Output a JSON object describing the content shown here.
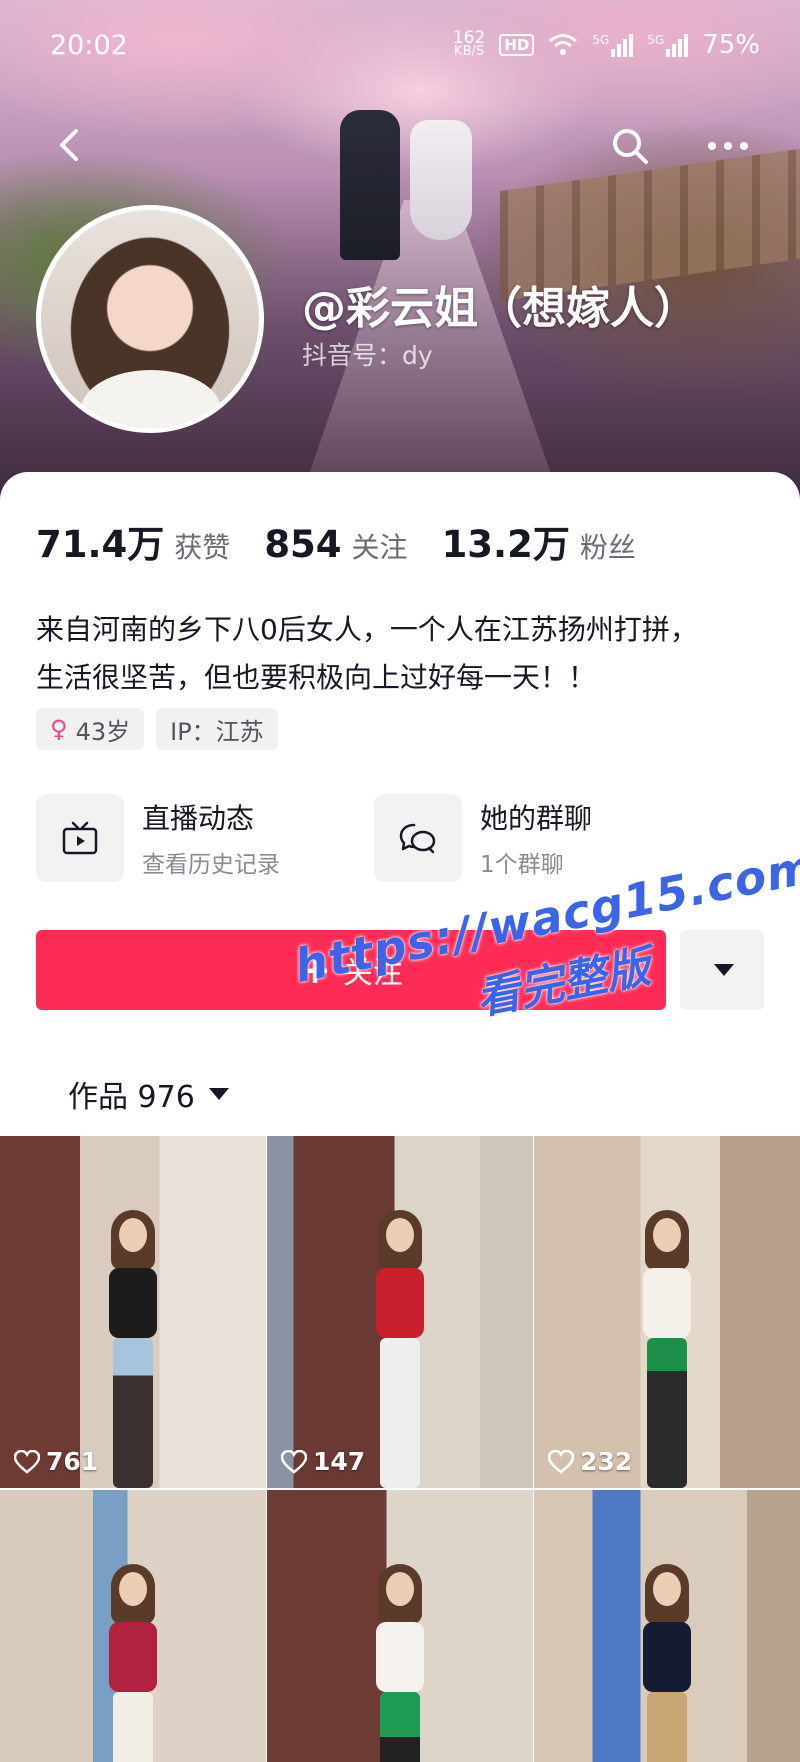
{
  "status_bar": {
    "time": "20:02",
    "net_speed_value": "162",
    "net_speed_unit": "KB/S",
    "hd_badge": "HD",
    "net_label_1": "5G",
    "net_label_2": "5G",
    "battery": "75%"
  },
  "profile": {
    "nickname": "@彩云姐（想嫁人）",
    "douyin_id": "抖音号：dy"
  },
  "stats": [
    {
      "value": "71.4万",
      "label": "获赞"
    },
    {
      "value": "854",
      "label": "关注"
    },
    {
      "value": "13.2万",
      "label": "粉丝"
    }
  ],
  "bio": {
    "line1": "来自河南的乡下八0后女人，一个人在江苏扬州打拼，",
    "line2": "生活很坚苦，但也要积极向上过好每一天！！"
  },
  "tags": {
    "age": "43岁",
    "ip": "IP：江苏"
  },
  "features": {
    "live": {
      "title": "直播动态",
      "subtitle": "查看历史记录",
      "icon": "tv-icon"
    },
    "group": {
      "title": "她的群聊",
      "subtitle": "1个群聊",
      "icon": "chat-bubbles-icon"
    }
  },
  "follow_button": {
    "label": "关注"
  },
  "works_tab": {
    "label": "作品 976"
  },
  "watermark": {
    "url": "https://wacg15.com",
    "text": "看完整版"
  },
  "videos": [
    {
      "likes": "761"
    },
    {
      "likes": "147"
    },
    {
      "likes": "232"
    },
    {
      "likes": ""
    },
    {
      "likes": ""
    },
    {
      "likes": ""
    }
  ],
  "colors": {
    "follow_accent": "#fe2c55",
    "watermark": "#3d63e6"
  }
}
